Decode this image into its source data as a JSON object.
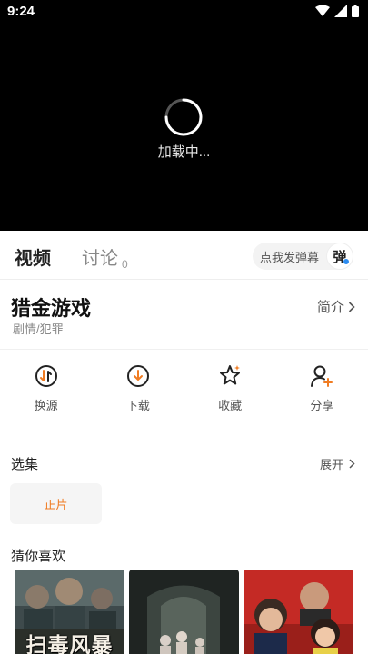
{
  "status_bar": {
    "time": "9:24"
  },
  "player": {
    "loading_text": "加载中..."
  },
  "tabs": {
    "video": "视频",
    "discuss": "讨论",
    "discuss_count": "0",
    "danmu_placeholder": "点我发弹幕",
    "danmu_button": "弹"
  },
  "show": {
    "title": "猎金游戏",
    "genre": "剧情/犯罪",
    "intro_label": "简介"
  },
  "actions": [
    {
      "label": "换源",
      "icon": "switch-source-icon"
    },
    {
      "label": "下载",
      "icon": "download-icon"
    },
    {
      "label": "收藏",
      "icon": "star-icon"
    },
    {
      "label": "分享",
      "icon": "share-user-icon"
    }
  ],
  "episodes": {
    "title": "选集",
    "expand_label": "展开",
    "items": [
      "正片"
    ]
  },
  "recommend": {
    "title": "猜你喜欢",
    "posters": [
      {
        "caption": "扫毒风暴"
      },
      {
        "caption": ""
      },
      {
        "caption": ""
      }
    ]
  },
  "colors": {
    "accent": "#f07c22",
    "badge": "#2d8cf0"
  }
}
